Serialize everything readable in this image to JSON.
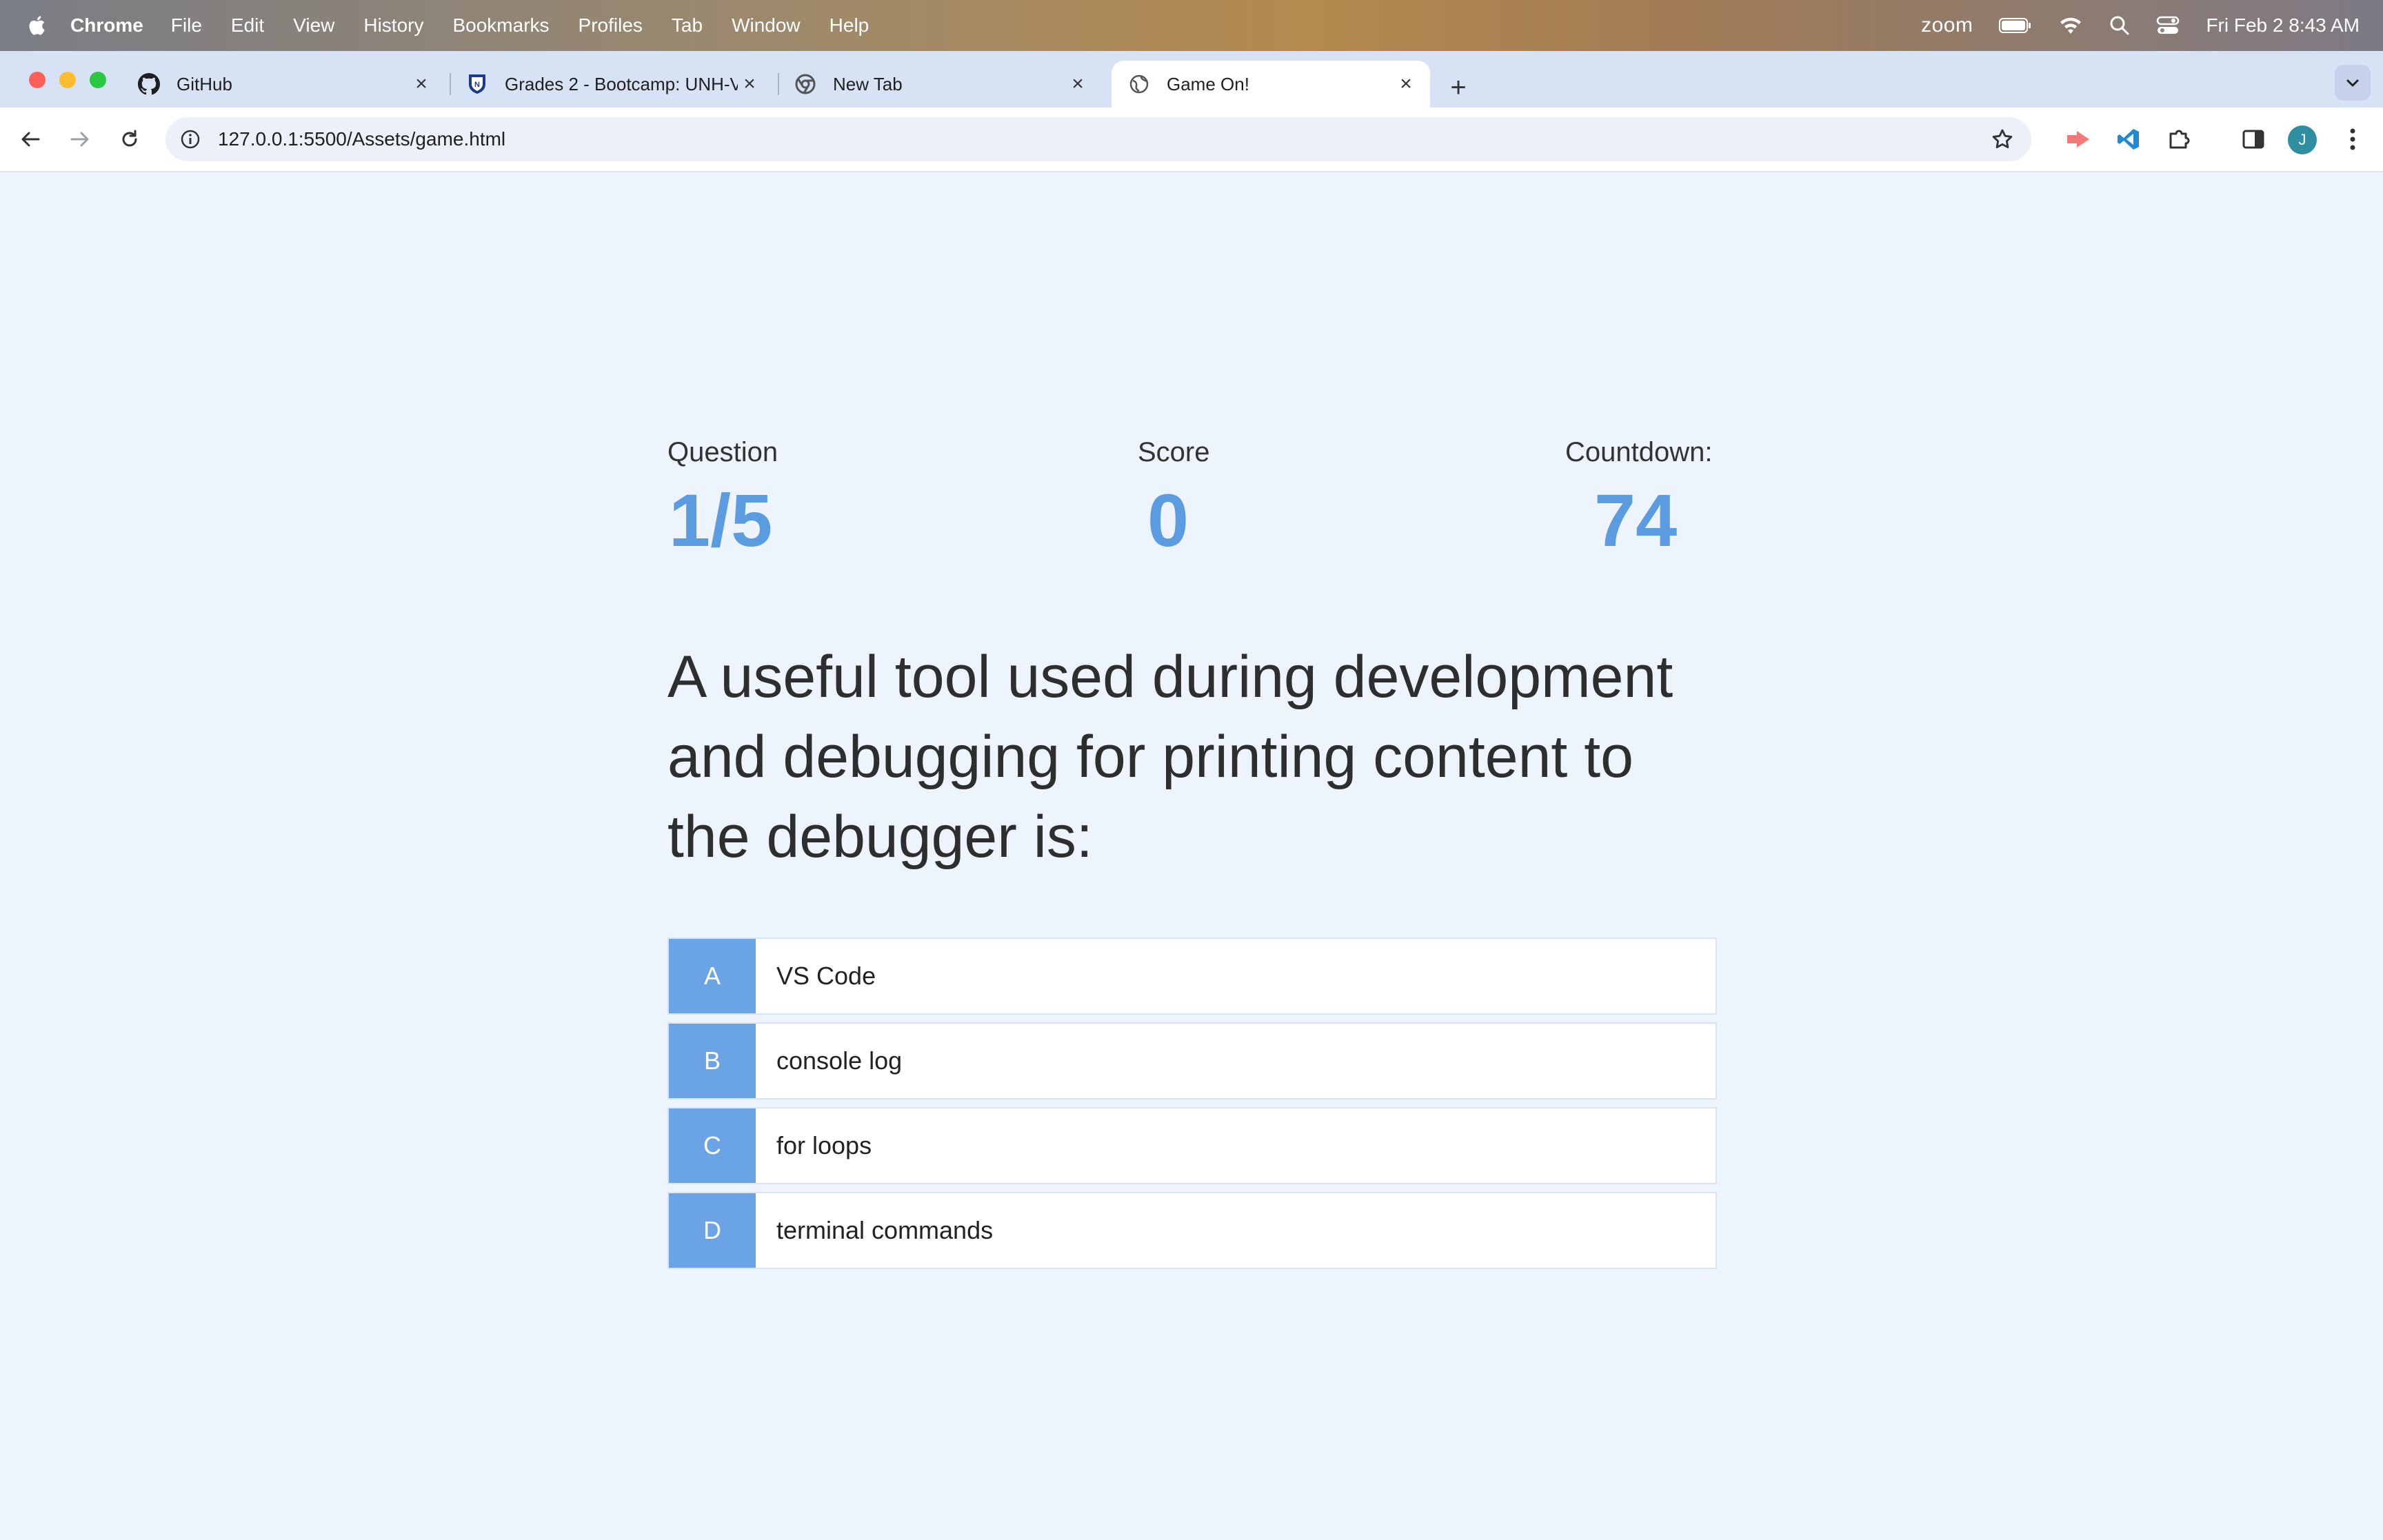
{
  "menubar": {
    "app": "Chrome",
    "items": [
      "File",
      "Edit",
      "View",
      "History",
      "Bookmarks",
      "Profiles",
      "Tab",
      "Window",
      "Help"
    ],
    "zoom": "zoom",
    "datetime": "Fri Feb 2  8:43 AM"
  },
  "tabs": [
    {
      "title": "GitHub",
      "icon": "github-icon"
    },
    {
      "title": "Grades 2 - Bootcamp: UNH-V",
      "icon": "unh-shield-icon"
    },
    {
      "title": "New Tab",
      "icon": "chrome-icon"
    },
    {
      "title": "Game On!",
      "icon": "globe-icon",
      "active": true
    }
  ],
  "toolbar": {
    "url": "127.0.0.1:5500/Assets/game.html",
    "avatar_letter": "J"
  },
  "hud": {
    "question_label": "Question",
    "question_value": "1/5",
    "score_label": "Score",
    "score_value": "0",
    "countdown_label": "Countdown:",
    "countdown_value": "74"
  },
  "question": "A useful tool used during development and debugging for printing content to the debugger is:",
  "choices": [
    {
      "prefix": "A",
      "text": "VS Code"
    },
    {
      "prefix": "B",
      "text": "console log"
    },
    {
      "prefix": "C",
      "text": "for loops"
    },
    {
      "prefix": "D",
      "text": "terminal commands"
    }
  ],
  "colors": {
    "accent": "#5b9be0",
    "choice_prefix_bg": "#6aa4e4",
    "page_bg": "#edf4fd"
  }
}
